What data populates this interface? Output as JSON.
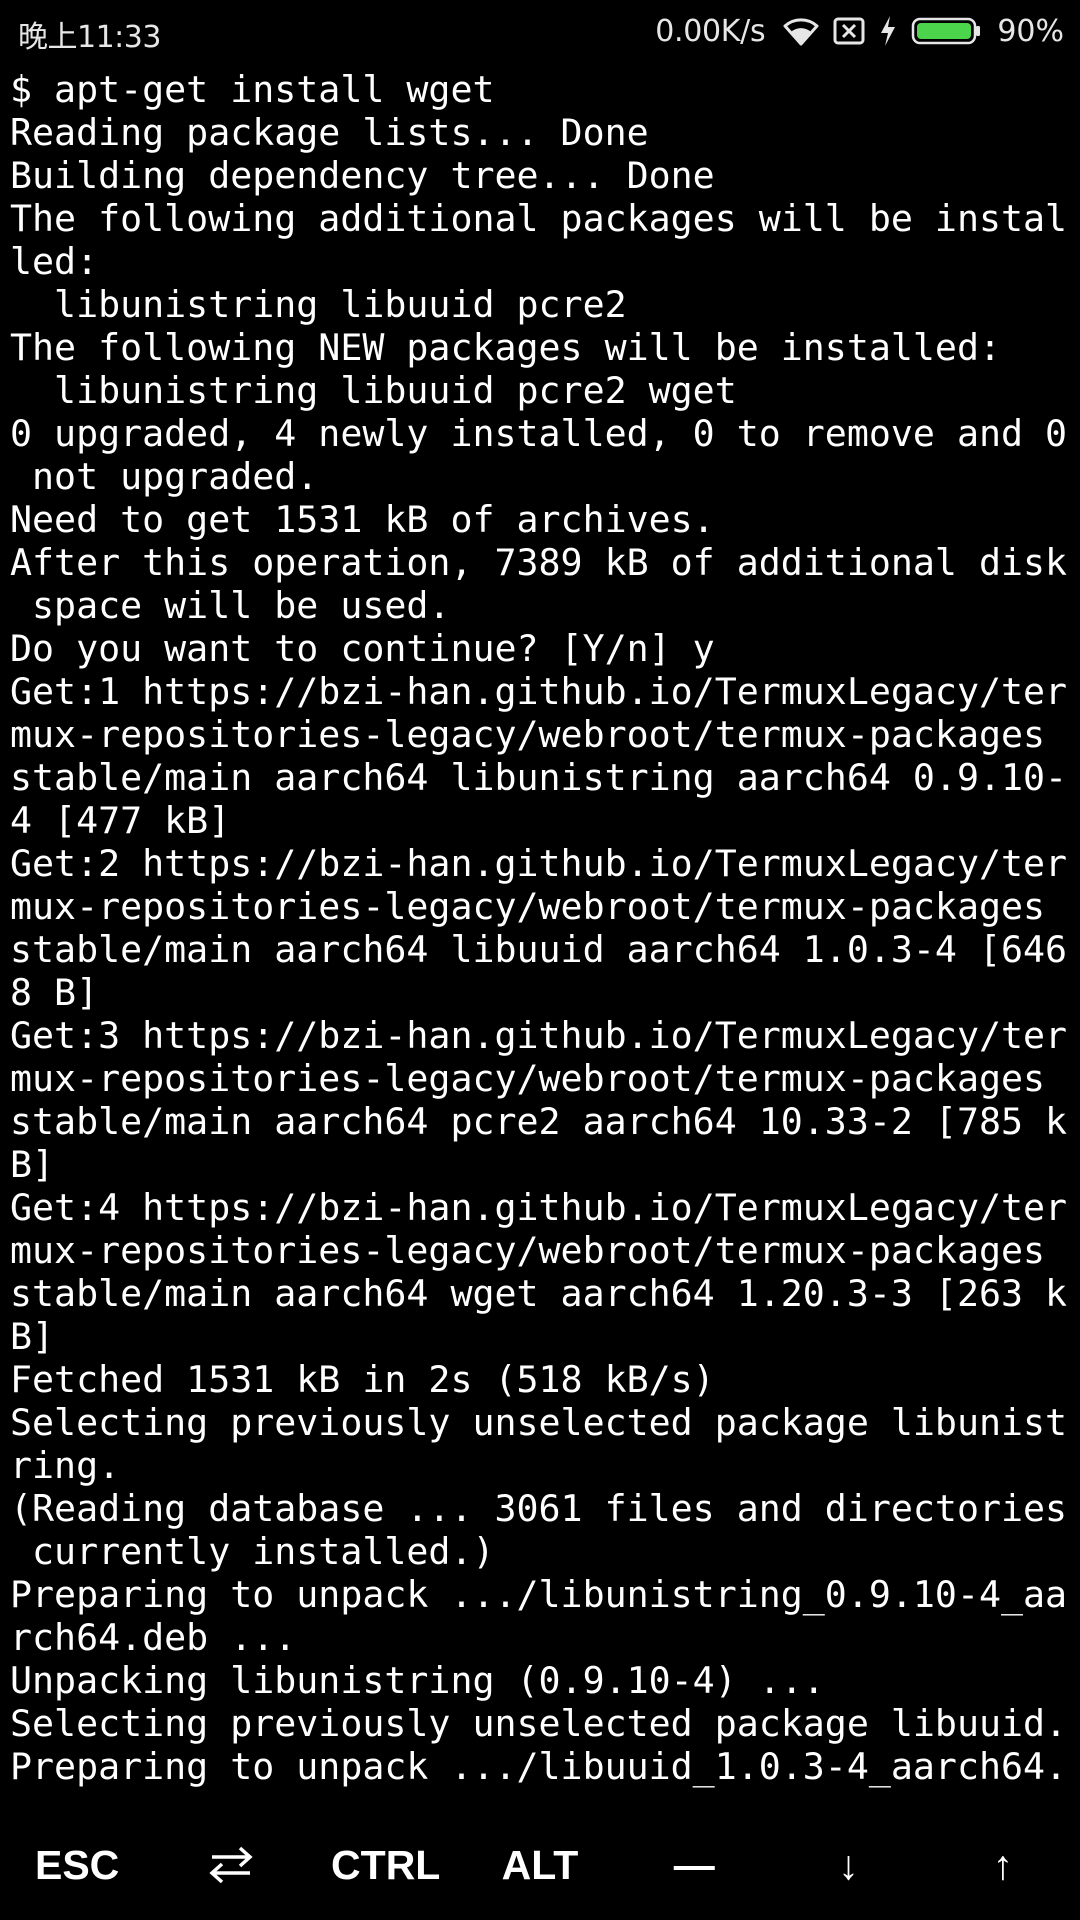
{
  "status_bar": {
    "time": "晚上11:33",
    "net_speed": "0.00K/s",
    "battery_percent": "90%",
    "icons": [
      "wifi-icon",
      "sim-disabled-icon",
      "charging-icon",
      "battery-icon"
    ],
    "battery_color": "#4cd44c"
  },
  "terminal": {
    "lines": [
      "$ apt-get install wget",
      "Reading package lists... Done",
      "Building dependency tree... Done",
      "The following additional packages will be instal",
      "led:",
      "  libunistring libuuid pcre2",
      "The following NEW packages will be installed:",
      "  libunistring libuuid pcre2 wget",
      "0 upgraded, 4 newly installed, 0 to remove and 0",
      " not upgraded.",
      "Need to get 1531 kB of archives.",
      "After this operation, 7389 kB of additional disk",
      " space will be used.",
      "Do you want to continue? [Y/n] y",
      "Get:1 https://bzi-han.github.io/TermuxLegacy/ter",
      "mux-repositories-legacy/webroot/termux-packages",
      "stable/main aarch64 libunistring aarch64 0.9.10-",
      "4 [477 kB]",
      "Get:2 https://bzi-han.github.io/TermuxLegacy/ter",
      "mux-repositories-legacy/webroot/termux-packages",
      "stable/main aarch64 libuuid aarch64 1.0.3-4 [646",
      "8 B]",
      "Get:3 https://bzi-han.github.io/TermuxLegacy/ter",
      "mux-repositories-legacy/webroot/termux-packages",
      "stable/main aarch64 pcre2 aarch64 10.33-2 [785 k",
      "B]",
      "Get:4 https://bzi-han.github.io/TermuxLegacy/ter",
      "mux-repositories-legacy/webroot/termux-packages",
      "stable/main aarch64 wget aarch64 1.20.3-3 [263 k",
      "B]",
      "Fetched 1531 kB in 2s (518 kB/s)",
      "Selecting previously unselected package libunist",
      "ring.",
      "(Reading database ... 3061 files and directories",
      " currently installed.)",
      "Preparing to unpack .../libunistring_0.9.10-4_aa",
      "rch64.deb ...",
      "Unpacking libunistring (0.9.10-4) ...",
      "Selecting previously unselected package libuuid.",
      "Preparing to unpack .../libuuid_1.0.3-4_aarch64."
    ]
  },
  "extra_keys": {
    "esc": "ESC",
    "tab_icon": "tab-arrows-icon",
    "ctrl": "CTRL",
    "alt": "ALT",
    "dash": "—",
    "down": "↓",
    "up": "↑"
  }
}
